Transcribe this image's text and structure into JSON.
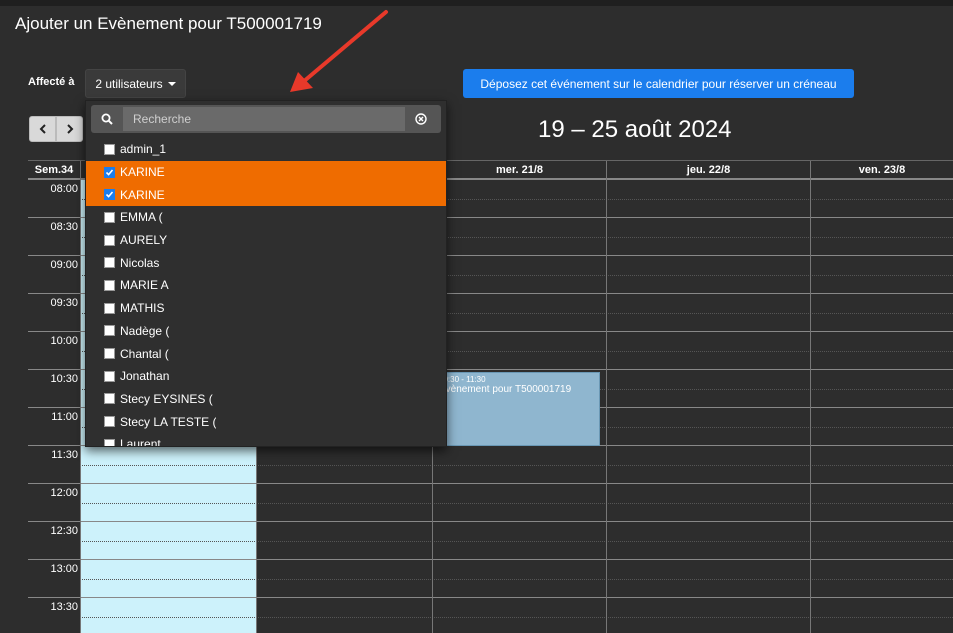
{
  "modal": {
    "title": "Ajouter un Evènement pour T500001719",
    "assign_label": "Affecté à",
    "assign_value": "2 utilisateurs",
    "drop_button": "Déposez cet événement sur le calendrier pour réserver un créneau"
  },
  "nav": {
    "prev_icon": "chevron-left-icon",
    "next_icon": "chevron-right-icon"
  },
  "calendar": {
    "range_title": "19 – 25 août 2024",
    "week_label": "Sem.34",
    "days": [
      {
        "label": ""
      },
      {
        "label": ""
      },
      {
        "label": "mer. 21/8"
      },
      {
        "label": "jeu. 22/8"
      },
      {
        "label": "ven. 23/8"
      }
    ],
    "times": [
      "08:00",
      "08:30",
      "09:00",
      "09:30",
      "10:00",
      "10:30",
      "11:00",
      "11:30",
      "12:00",
      "12:30",
      "13:00",
      "13:30"
    ],
    "event": {
      "time": "10:30 - 11:30",
      "title": "Evènement pour T500001719"
    }
  },
  "dropdown": {
    "search_placeholder": "Recherche",
    "options": [
      {
        "label": "admin_1",
        "checked": false
      },
      {
        "label": "KARINE",
        "checked": true
      },
      {
        "label": "KARINE",
        "checked": true
      },
      {
        "label": "EMMA (",
        "checked": false
      },
      {
        "label": "AURELY",
        "checked": false
      },
      {
        "label": "Nicolas",
        "checked": false
      },
      {
        "label": "MARIE A",
        "checked": false
      },
      {
        "label": "MATHIS",
        "checked": false
      },
      {
        "label": "Nadège (",
        "checked": false
      },
      {
        "label": "Chantal (",
        "checked": false
      },
      {
        "label": "Jonathan",
        "checked": false
      },
      {
        "label": "Stecy EYSINES (",
        "checked": false
      },
      {
        "label": "Stecy LA TESTE (",
        "checked": false
      },
      {
        "label": "Laurent",
        "checked": false
      }
    ]
  },
  "colors": {
    "accent": "#ef6c00",
    "primary": "#1b7ded",
    "today": "#cdf2fb",
    "event": "#8fb6cf",
    "annotation_arrow": "#e8392a"
  }
}
